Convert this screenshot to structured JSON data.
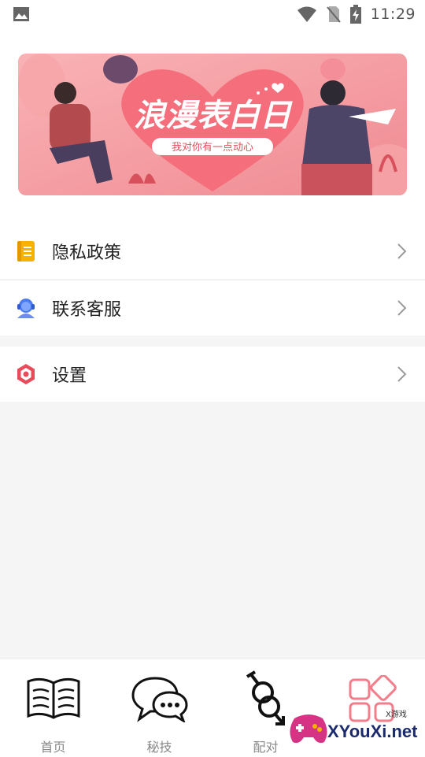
{
  "status_bar": {
    "time": "11:29"
  },
  "banner": {
    "title": "浪漫表白日",
    "subtitle": "我对你有一点动心"
  },
  "menu": [
    {
      "label": "隐私政策",
      "icon": "notebook-icon"
    },
    {
      "label": "联系客服",
      "icon": "customer-service-icon"
    },
    {
      "label": "设置",
      "icon": "settings-icon"
    }
  ],
  "bottom_nav": [
    {
      "label": "首页",
      "icon": "book-icon"
    },
    {
      "label": "秘技",
      "icon": "chat-bubbles-icon"
    },
    {
      "label": "配对",
      "icon": "gender-link-icon"
    },
    {
      "label": "",
      "icon": "grid-apps-icon"
    }
  ],
  "watermark": {
    "brand": "XYouXi.net",
    "tag": "X游戏"
  },
  "colors": {
    "accent_pink": "#f27d8b",
    "settings_red": "#e84c5a",
    "notebook_yellow": "#f5b200",
    "service_blue": "#4a7cf0"
  }
}
